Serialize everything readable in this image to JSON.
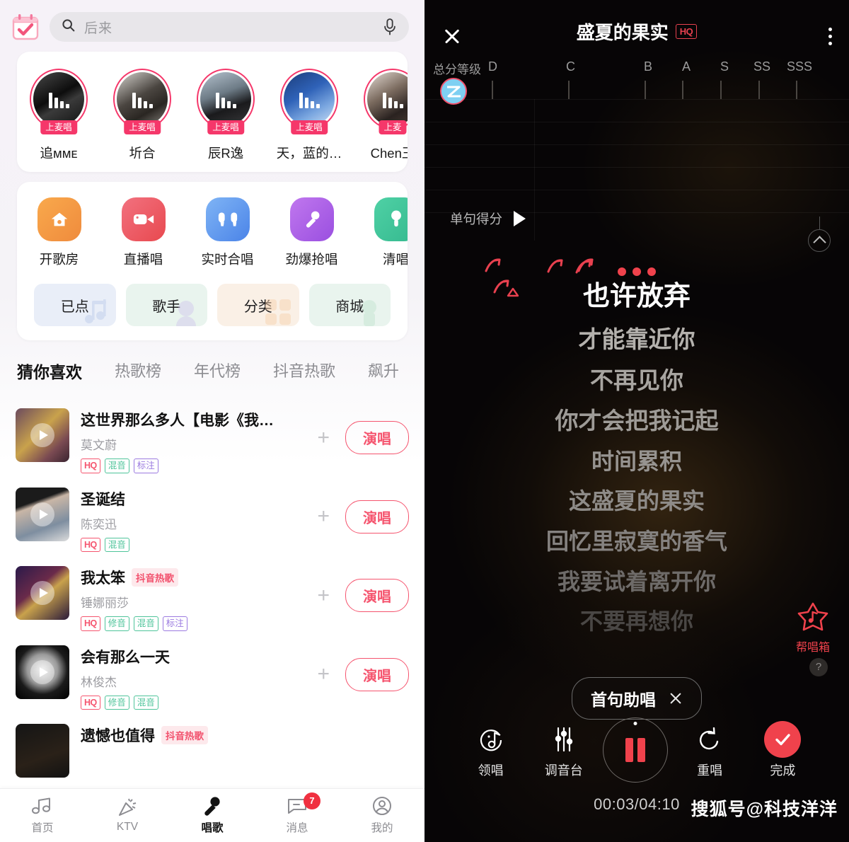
{
  "left": {
    "search": {
      "placeholder": "后来",
      "search_icon": "search-icon",
      "mic_icon": "voice-mic-icon",
      "calendar_icon": "calendar-check-icon"
    },
    "live_users": [
      {
        "name": "追ᴍᴍᴇ",
        "badge": "上麦唱"
      },
      {
        "name": "圻合",
        "badge": "上麦唱"
      },
      {
        "name": "辰R逸",
        "badge": "上麦唱"
      },
      {
        "name": "天，蓝的…",
        "badge": "上麦唱"
      },
      {
        "name": "Chen王",
        "badge": "上麦"
      }
    ],
    "features": [
      {
        "label": "开歌房",
        "icon": "house-icon"
      },
      {
        "label": "直播唱",
        "icon": "video-camera-icon"
      },
      {
        "label": "实时合唱",
        "icon": "two-mics-icon"
      },
      {
        "label": "劲爆抢唱",
        "icon": "microphone-icon"
      },
      {
        "label": "清唱",
        "icon": "mic-stand-icon"
      }
    ],
    "quick_links": [
      {
        "label": "已点",
        "icon": "music-note-icon"
      },
      {
        "label": "歌手",
        "icon": "singer-icon"
      },
      {
        "label": "分类",
        "icon": "grid-icon"
      },
      {
        "label": "商城",
        "icon": "mall-icon"
      }
    ],
    "tabs": [
      {
        "label": "猜你喜欢",
        "active": true
      },
      {
        "label": "热歌榜",
        "active": false
      },
      {
        "label": "年代榜",
        "active": false
      },
      {
        "label": "抖音热歌",
        "active": false
      },
      {
        "label": "飙升",
        "active": false
      }
    ],
    "songs": [
      {
        "title": "这世界那么多人【电影《我…",
        "artist": "莫文蔚",
        "hot_badge": "",
        "tags": [
          "HQ",
          "混音",
          "标注"
        ],
        "sing_label": "演唱",
        "add_label": "+"
      },
      {
        "title": "圣诞结",
        "artist": "陈奕迅",
        "hot_badge": "",
        "tags": [
          "HQ",
          "混音"
        ],
        "sing_label": "演唱",
        "add_label": "+"
      },
      {
        "title": "我太笨",
        "artist": "锤娜丽莎",
        "hot_badge": "抖音热歌",
        "tags": [
          "HQ",
          "修音",
          "混音",
          "标注"
        ],
        "sing_label": "演唱",
        "add_label": "+"
      },
      {
        "title": "会有那么一天",
        "artist": "林俊杰",
        "hot_badge": "",
        "tags": [
          "HQ",
          "修音",
          "混音"
        ],
        "sing_label": "演唱",
        "add_label": "+"
      },
      {
        "title": "遗憾也值得",
        "artist": "",
        "hot_badge": "抖音热歌",
        "tags": [],
        "sing_label": "演唱",
        "add_label": "+"
      }
    ],
    "nav": [
      {
        "label": "首页",
        "icon": "music-notes-icon",
        "active": false,
        "badge": ""
      },
      {
        "label": "KTV",
        "icon": "party-popper-icon",
        "active": false,
        "badge": ""
      },
      {
        "label": "唱歌",
        "icon": "microphone-icon",
        "active": true,
        "badge": ""
      },
      {
        "label": "消息",
        "icon": "chat-bubble-icon",
        "active": false,
        "badge": "7"
      },
      {
        "label": "我的",
        "icon": "person-icon",
        "active": false,
        "badge": ""
      }
    ]
  },
  "right": {
    "header": {
      "close_icon": "close-x-icon",
      "title": "盛夏的果实",
      "hq_badge": "HQ",
      "menu_icon": "more-vertical-icon"
    },
    "grade": {
      "label": "总分等级",
      "ticks": [
        "D",
        "C",
        "B",
        "A",
        "S",
        "SS",
        "SSS"
      ],
      "avatar_icon": "user-avatar-z-icon"
    },
    "pitch": {
      "score_label": "单句得分",
      "play_icon": "play-triangle-icon",
      "collapse_icon": "chevron-up-icon"
    },
    "lyrics": {
      "dots_icon": "three-dots-indicator",
      "lines": [
        {
          "text": "也许放弃",
          "state": "current"
        },
        {
          "text": "才能靠近你",
          "state": "next1"
        },
        {
          "text": "不再见你",
          "state": "next2"
        },
        {
          "text": "你才会把我记起",
          "state": "next3"
        },
        {
          "text": "时间累积",
          "state": "next4"
        },
        {
          "text": "这盛夏的果实",
          "state": "next5"
        },
        {
          "text": "回忆里寂寞的香气",
          "state": "next6"
        },
        {
          "text": "我要试着离开你",
          "state": "next7"
        },
        {
          "text": "不要再想你",
          "state": "next8"
        }
      ]
    },
    "help_box": {
      "label": "帮唱箱",
      "icon": "star-music-icon"
    },
    "question_button": {
      "label": "?",
      "icon": "question-mark-icon"
    },
    "assist": {
      "label": "首句助唱",
      "close_icon": "close-x-icon"
    },
    "controls": [
      {
        "label": "领唱",
        "icon": "lead-vocal-icon"
      },
      {
        "label": "调音台",
        "icon": "mixer-sliders-icon"
      },
      {
        "label": "",
        "icon": "pause-icon"
      },
      {
        "label": "重唱",
        "icon": "restart-arrow-icon"
      },
      {
        "label": "完成",
        "icon": "check-circle-icon"
      }
    ],
    "time": "00:03/04:10",
    "watermark": "搜狐号@科技洋洋"
  },
  "colors": {
    "accent_pink": "#f5376a",
    "accent_red": "#f0424c",
    "tag_hq": "#f5546e",
    "tag_green": "#4ec49a",
    "tag_purple": "#9b7ae0"
  }
}
